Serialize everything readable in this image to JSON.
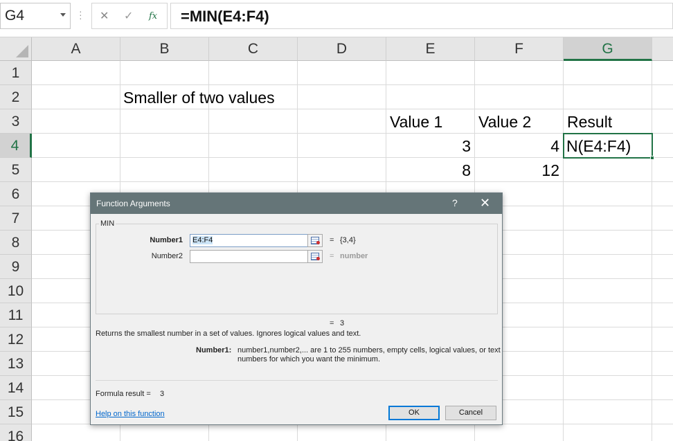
{
  "formula_bar": {
    "name_box": "G4",
    "cancel_icon": "✕",
    "enter_icon": "✓",
    "fx_label": "fx",
    "formula": "=MIN(E4:F4)"
  },
  "sheet": {
    "columns": [
      "A",
      "B",
      "C",
      "D",
      "E",
      "F",
      "G"
    ],
    "selected_column": "G",
    "rows": [
      "1",
      "2",
      "3",
      "4",
      "5",
      "6",
      "7",
      "8",
      "9",
      "10",
      "11",
      "12",
      "13",
      "14",
      "15",
      "16"
    ],
    "selected_row": "4",
    "cells": {
      "B2": "Smaller of two values",
      "E3": "Value 1",
      "F3": "Value 2",
      "G3": "Result",
      "E4": "3",
      "F4": "4",
      "G4": "N(E4:F4)",
      "E5": "8",
      "F5": "12"
    }
  },
  "dialog": {
    "title": "Function Arguments",
    "help_button": "?",
    "close_button": "✕",
    "function_name": "MIN",
    "args": [
      {
        "label": "Number1",
        "value": "E4:F4",
        "result": "{3,4}"
      },
      {
        "label": "Number2",
        "value": "",
        "result": "number"
      }
    ],
    "eq": "=",
    "overall_result": "3",
    "description": "Returns the smallest number in a set of values. Ignores logical values and text.",
    "arg_desc_name": "Number1:",
    "arg_desc_text": "number1,number2,... are 1 to 255 numbers, empty cells, logical values, or text numbers for which you want the minimum.",
    "formula_result_label": "Formula result =",
    "formula_result_value": "3",
    "help_link": "Help on this function",
    "ok_label": "OK",
    "cancel_label": "Cancel"
  }
}
